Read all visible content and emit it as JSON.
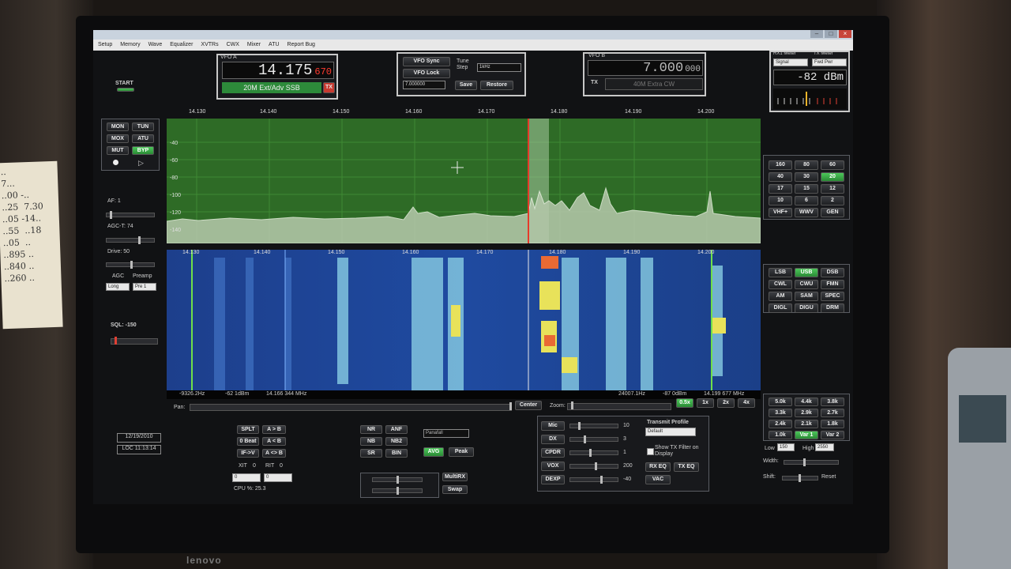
{
  "room": {
    "note_text": "..\n7...\n..00 -..\n..25  7.30\n..05 -14..\n..55  ..18\n..05  ..\n..895 ..\n..840 ..\n..260 ..",
    "laptop_brand": "lenovo"
  },
  "menu": [
    "Setup",
    "Memory",
    "Wave",
    "Equalizer",
    "XVTRs",
    "CWX",
    "Mixer",
    "ATU",
    "Report Bug"
  ],
  "start_label": "START",
  "vfo_a": {
    "label": "VFO A",
    "freq_main": "14.175",
    "freq_sub": "670",
    "band_label": "20M Ext/Adv SSB",
    "tx": "TX"
  },
  "vfo_center": {
    "sync": "VFO Sync",
    "lock": "VFO Lock",
    "tune_step_label": "Tune Step",
    "tune_step_value": "1kHz",
    "step_freq": "7.000000",
    "save": "Save",
    "restore": "Restore"
  },
  "vfo_b": {
    "label": "VFO B",
    "freq_main": "7.000",
    "freq_sub": "000",
    "tx": "TX",
    "band_label": "40M Extra CW"
  },
  "meters": {
    "rx_label": "RX1 Meter",
    "tx_label": "TX Meter",
    "rx_mode": "Signal",
    "tx_mode": "Fwd Pwr",
    "reading": "-82 dBm"
  },
  "left_buttons": {
    "mon": "MON",
    "tun": "TUN",
    "mox": "MOX",
    "atu": "ATU",
    "mut": "MUT",
    "byp": "BYP"
  },
  "left_controls": {
    "af": "AF: 1",
    "agc_t": "AGC-T: 74",
    "drive": "Drive: 50",
    "agc": "AGC",
    "preamp": "Preamp",
    "agc_value": "Long",
    "preamp_value": "Pre 1",
    "sql": "SQL: -150"
  },
  "freq_axis": [
    "14.130",
    "14.140",
    "14.150",
    "14.160",
    "14.170",
    "14.180",
    "14.190",
    "14.200"
  ],
  "db_axis": [
    "-40",
    "-60",
    "-80",
    "-100",
    "-120",
    "-140"
  ],
  "readouts": {
    "left_hz": "-9326.2Hz",
    "left_dbm": "-62 1dBm",
    "left_mhz": "14.166 344 MHz",
    "right_hz": "24007.1Hz",
    "right_dbm": "-87 0dBm",
    "right_mhz": "14.199 677 MHz"
  },
  "pan_row": {
    "pan": "Pan:",
    "center": "Center",
    "zoom": "Zoom:",
    "zoom_levels": [
      "0.5x",
      "1x",
      "2x",
      "4x"
    ]
  },
  "bands": [
    "160",
    "80",
    "60",
    "40",
    "30",
    "20",
    "17",
    "15",
    "12",
    "10",
    "6",
    "2",
    "VHF+",
    "WWV",
    "GEN"
  ],
  "band_active": "20",
  "modes": [
    "LSB",
    "USB",
    "DSB",
    "CWL",
    "CWU",
    "FMN",
    "AM",
    "SAM",
    "SPEC",
    "DIGL",
    "DIGU",
    "DRM"
  ],
  "mode_active": "USB",
  "filters": [
    "5.0k",
    "4.4k",
    "3.8k",
    "3.3k",
    "2.9k",
    "2.7k",
    "2.4k",
    "2.1k",
    "1.8k",
    "1.0k",
    "Var 1",
    "Var 2"
  ],
  "filter_active": "Var 1",
  "filter_controls": {
    "low": "Low",
    "low_val": "150",
    "high": "High",
    "high_val": "2550",
    "width": "Width:",
    "shift": "Shift:",
    "reset": "Reset"
  },
  "date_box": {
    "date": "12/19/2010",
    "time": "LOC 11:13:14"
  },
  "vfo_ops": {
    "splt": "SPLT",
    "ab": "A > B",
    "zero_beat": "0 Beat",
    "ab2": "A < B",
    "ifv": "IF->V",
    "swap": "A <> B",
    "xit": "XIT",
    "xit_val": "0",
    "rit": "RIT",
    "rit_val": "0",
    "xit_box": "0",
    "rit_box": "0",
    "cpu": "CPU %: 25.3"
  },
  "dsp": {
    "nr": "NR",
    "anf": "ANF",
    "nb": "NB",
    "nb2": "NB2",
    "sr": "SR",
    "bin": "BIN",
    "display_mode": "Panafall",
    "avg": "AVG",
    "peak": "Peak"
  },
  "multirx": {
    "multi": "MultiRX",
    "swap": "Swap"
  },
  "tx_sliders": [
    {
      "label": "Mic",
      "value": "10"
    },
    {
      "label": "DX",
      "value": "3"
    },
    {
      "label": "CPDR",
      "value": "1"
    },
    {
      "label": "VOX",
      "value": "200"
    },
    {
      "label": "DEXP",
      "value": "-40"
    }
  ],
  "tx_profile": {
    "label": "Transmit Profile",
    "value": "Default",
    "show_filter": "Show TX Filter on Display",
    "rx_eq": "RX EQ",
    "tx_eq": "TX EQ",
    "vac": "VAC"
  },
  "colors": {
    "green_on": "#3fb54c",
    "lcd_red": "#ff3b2f",
    "spectrum_bg": "#2e6b26",
    "band_active": "#3fb54c"
  }
}
